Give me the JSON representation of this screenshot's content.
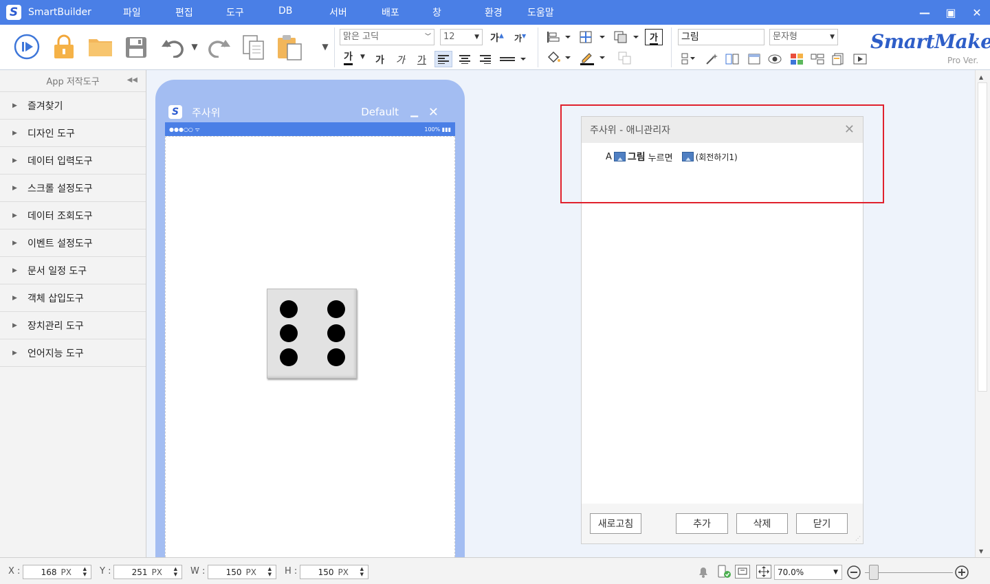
{
  "titlebar": {
    "app_name": "SmartBuilder",
    "menus": [
      "파일",
      "편집",
      "도구",
      "DB",
      "서버",
      "배포",
      "창",
      "환경",
      "도움말"
    ],
    "minimize": "—",
    "maximize": "▣",
    "close": "✕"
  },
  "toolbar": {
    "font_name": "맑은 고딕",
    "font_size": "12",
    "grow_font": "가",
    "shrink_font": "가",
    "text_color": "가",
    "bold": "가",
    "italic": "가",
    "underline": "가",
    "border_text": "가",
    "object_name": "그림",
    "object_type": "문자형",
    "brand": "SmartMaker",
    "brand_sub": "Pro Ver."
  },
  "left_panel": {
    "title": "App 저작도구",
    "items": [
      "즐겨찾기",
      "디자인 도구",
      "데이터 입력도구",
      "스크롤 설정도구",
      "데이터 조회도구",
      "이벤트 설정도구",
      "문서 일정 도구",
      "객체 삽입도구",
      "장치관리 도구",
      "언어지능 도구"
    ]
  },
  "phone": {
    "title": "주사위",
    "mode": "Default",
    "status_left": "●●●○○ ᯤ",
    "status_right": "100% ▮▮▮",
    "dice_pips": 6
  },
  "dialog": {
    "title": "주사위 - 애니관리자",
    "close": "✕",
    "row": {
      "prefix": "A",
      "object": "그림",
      "trigger": "누르면",
      "action": "(회전하기1)"
    },
    "buttons": {
      "refresh": "새로고침",
      "add": "추가",
      "delete": "삭제",
      "close": "닫기"
    }
  },
  "statusbar": {
    "x_label": "X :",
    "x_value": "168",
    "x_unit": "PX",
    "y_label": "Y :",
    "y_value": "251",
    "y_unit": "PX",
    "w_label": "W :",
    "w_value": "150",
    "w_unit": "PX",
    "h_label": "H :",
    "h_value": "150",
    "h_unit": "PX",
    "zoom": "70.0%"
  },
  "colors": {
    "titlebar": "#4a7fe6",
    "phone_frame": "#a3bdf2",
    "highlight": "#e0202c",
    "brand": "#2e5ec8"
  }
}
